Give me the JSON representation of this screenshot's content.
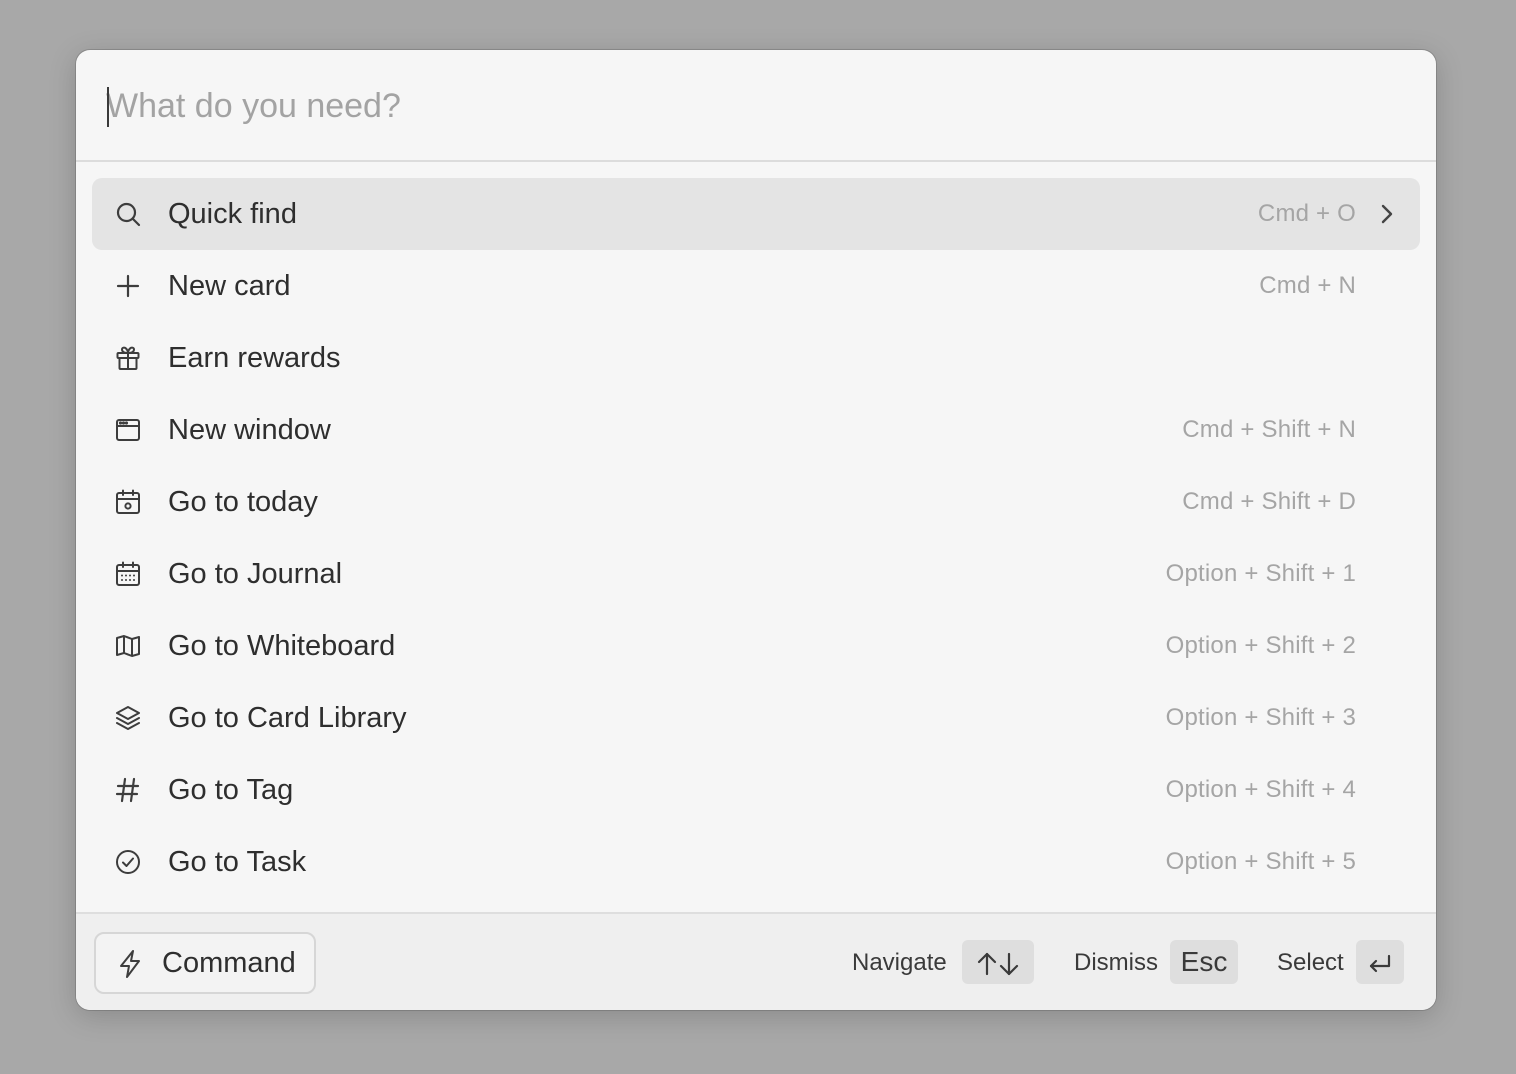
{
  "search": {
    "placeholder": "What do you need?",
    "value": ""
  },
  "items": [
    {
      "label": "Quick find",
      "shortcut": "Cmd + O",
      "icon": "search-icon",
      "selected": true
    },
    {
      "label": "New card",
      "shortcut": "Cmd + N",
      "icon": "plus-icon"
    },
    {
      "label": "Earn rewards",
      "shortcut": "",
      "icon": "gift-icon"
    },
    {
      "label": "New window",
      "shortcut": "Cmd + Shift + N",
      "icon": "window-icon"
    },
    {
      "label": "Go to today",
      "shortcut": "Cmd + Shift + D",
      "icon": "calendar-today-icon"
    },
    {
      "label": "Go to Journal",
      "shortcut": "Option + Shift + 1",
      "icon": "calendar-grid-icon"
    },
    {
      "label": "Go to Whiteboard",
      "shortcut": "Option + Shift + 2",
      "icon": "map-icon"
    },
    {
      "label": "Go to Card Library",
      "shortcut": "Option + Shift + 3",
      "icon": "layers-icon"
    },
    {
      "label": "Go to Tag",
      "shortcut": "Option + Shift + 4",
      "icon": "hash-icon"
    },
    {
      "label": "Go to Task",
      "shortcut": "Option + Shift + 5",
      "icon": "check-circle-icon"
    }
  ],
  "footer": {
    "command_label": "Command",
    "command_icon": "lightning-icon",
    "navigate_label": "Navigate",
    "navigate_keys_icons": [
      "arrow-up-icon",
      "arrow-down-icon"
    ],
    "dismiss_label": "Dismiss",
    "dismiss_key": "Esc",
    "select_label": "Select",
    "select_key_icon": "enter-key-icon"
  },
  "colors": {
    "backdrop": "#a8a8a8",
    "panel": "#f6f6f6",
    "selected_row": "#e4e4e4",
    "footer": "#efefef",
    "shortcut_text": "#a5a5a5",
    "key_bg": "#dedede"
  }
}
